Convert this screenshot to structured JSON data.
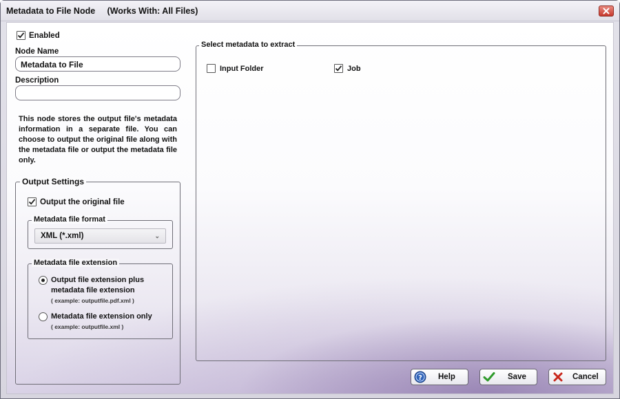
{
  "window": {
    "title": "Metadata to File Node     (Works With: All Files)"
  },
  "left": {
    "enabled_label": "Enabled",
    "enabled_checked": true,
    "node_name_label": "Node Name",
    "node_name_value": "Metadata to File",
    "description_label": "Description",
    "description_value": "",
    "description_text": "This node stores the output file's metadata information in a separate file. You can choose to output the original file along with the metadata file or output the metadata file only."
  },
  "output_settings": {
    "legend": "Output Settings",
    "output_original_label": "Output the original file",
    "output_original_checked": true,
    "format_group_legend": "Metadata file format",
    "format_selected": "XML (*.xml)",
    "extension_group_legend": "Metadata file extension",
    "ext_option1_line1": "Output file extension plus",
    "ext_option1_line2": "metadata file extension",
    "ext_option1_example": "( example: outputfile.pdf.xml )",
    "ext_option1_selected": true,
    "ext_option2_label": "Metadata file extension only",
    "ext_option2_example": "( example: outputfile.xml )",
    "ext_option2_selected": false
  },
  "metadata_select": {
    "legend": "Select metadata to extract",
    "input_folder_label": "Input Folder",
    "input_folder_checked": false,
    "job_label": "Job",
    "job_checked": true
  },
  "buttons": {
    "help": "Help",
    "save": "Save",
    "cancel": "Cancel"
  }
}
